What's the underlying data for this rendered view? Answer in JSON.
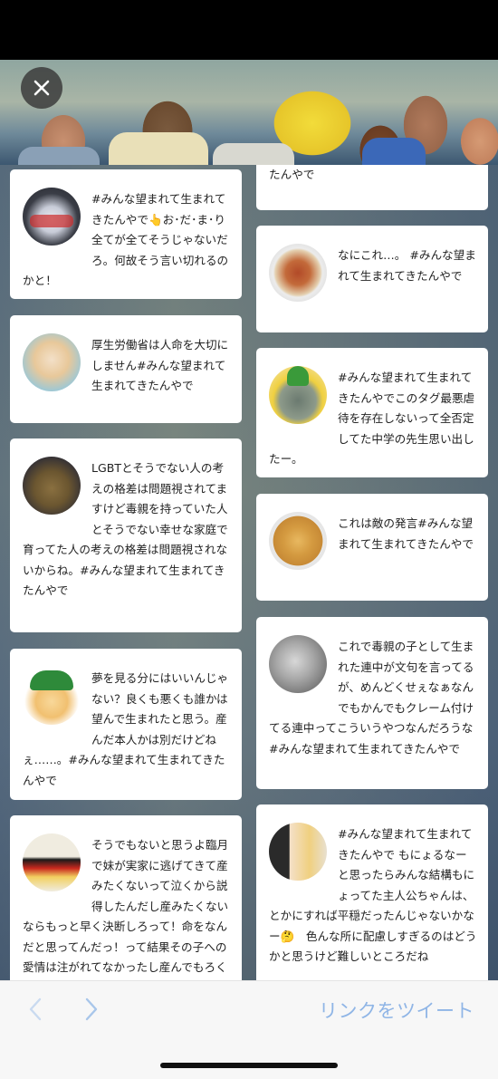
{
  "header": {
    "close_icon": "close-icon"
  },
  "feed": {
    "left": [
      {
        "avatar": "avatar-sports-car",
        "text": "#みんな望まれて生まれてきたんやで👆お･だ･ま･り全てが全てそうじゃないだろ。何故そう言い切れるのかと！"
      },
      {
        "avatar": "avatar-anime-girl",
        "text": "厚生労働省は人命を大切にしません#みんな望まれて生まれてきたんやで"
      },
      {
        "avatar": "avatar-figurine",
        "text": "LGBTとそうでない人の考えの格差は問題視されてますけど毒親を持っていた人とそうでない幸せな家庭で育ってた人の考えの格差は問題視されないからね。#みんな望まれて生まれてきたんやで"
      },
      {
        "avatar": "avatar-green-hat-girl",
        "text": "夢を見る分にはいいんじゃない？良くも悪くも誰かは望んで生まれたと思う。産んだ本人かは別だけどねぇ……。#みんな望まれて生まれてきたんやで"
      },
      {
        "avatar": "avatar-poster",
        "text": "そうでもないと思うよ臨月で妹が実家に逃げてきて産みたくないって泣くから説得したんだし産みたくないならもっと早く決断しろって！命をなんだと思ってんだっ！って結果その子への愛情は注がれてなかったし産んでもろくでもな"
      }
    ],
    "right": [
      {
        "avatar": "",
        "text": "たんやで"
      },
      {
        "avatar": "avatar-curry-bowl",
        "text": "なにこれ…。 #みんな望まれて生まれてきたんやで"
      },
      {
        "avatar": "avatar-pineapple-cat",
        "text": "#みんな望まれて生まれてきたんやでこのタグ最悪虐待を存在しないって全否定してた中学の先生思い出したー。"
      },
      {
        "avatar": "avatar-pizza",
        "text": "これは敵の発言#みんな望まれて生まれてきたんやで"
      },
      {
        "avatar": "avatar-statue",
        "text": "これで毒親の子として生まれた連中が文句を言ってるが、めんどくせぇなぁなんでもかんでもクレーム付けてる連中ってこういうやつなんだろうな #みんな望まれて生まれてきたんやで"
      },
      {
        "avatar": "avatar-two-anime-girls",
        "text": "#みんな望まれて生まれてきたんやで もにょるなーと思ったらみんな結構もにょってた主人公ちゃんは、とかにすれば平穏だったんじゃないかなー🤔　色んな所に配慮しすぎるのはどうかと思うけど難しいところだね"
      }
    ]
  },
  "bottom": {
    "back_icon": "chevron-left-icon",
    "forward_icon": "chevron-right-icon",
    "tweet_link": "リンクをツイート"
  },
  "colors": {
    "link": "#8fb5e6",
    "card": "#ffffff"
  }
}
